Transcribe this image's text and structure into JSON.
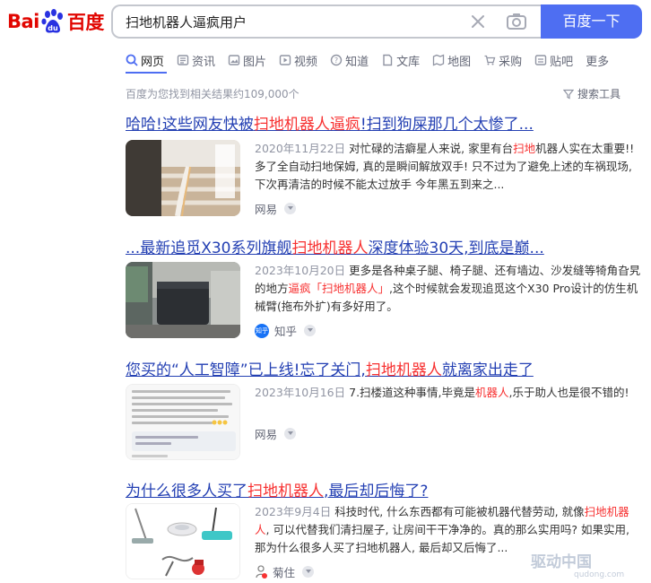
{
  "logo": {
    "left": "Bai",
    "right": "百度"
  },
  "search": {
    "query": "扫地机器人逼疯用户",
    "button": "百度一下"
  },
  "tabs": [
    {
      "label": "网页",
      "icon": "search-icon"
    },
    {
      "label": "资讯",
      "icon": "news-icon"
    },
    {
      "label": "图片",
      "icon": "image-icon"
    },
    {
      "label": "视频",
      "icon": "video-icon"
    },
    {
      "label": "知道",
      "icon": "question-icon"
    },
    {
      "label": "文库",
      "icon": "document-icon"
    },
    {
      "label": "地图",
      "icon": "map-icon"
    },
    {
      "label": "采购",
      "icon": "cart-icon"
    },
    {
      "label": "贴吧",
      "icon": "forum-icon"
    },
    {
      "label": "更多",
      "icon": ""
    }
  ],
  "stats": "百度为您找到相关结果约109,000个",
  "tools_label": "搜索工具",
  "results": [
    {
      "title_pre": "哈哈!这些网友快被",
      "title_em": "扫地机器人逼疯",
      "title_post": "!扫到狗屎那几个太惨了...",
      "date": "2020年11月22日",
      "abs_pre": "对忙碌的洁癖星人来说, 家里有台",
      "abs_em": "扫地",
      "abs_post": "机器人实在太重要!! 多了全自动扫地保姆, 真的是瞬间解放双手! 只不过为了避免上述的车祸现场, 下次再清洁的时候不能太过放手 今年黑五到来之...",
      "source": "网易"
    },
    {
      "title_pre": "...最新追觅X30系列旗舰",
      "title_em": "扫地机器人",
      "title_post": "深度体验30天,到底是巅...",
      "date": "2023年10月20日",
      "abs_pre": "更多是各种桌子腿、椅子腿、还有墙边、沙发缝等犄角旮旯的地方",
      "abs_em": "逼疯「扫地机器人」",
      "abs_post": ",这个时候就会发现追觅这个X30 Pro设计的仿生机械臂(拖布外扩)有多好用了。",
      "source": "知乎",
      "favicon": "知乎"
    },
    {
      "title_pre": "您买的“人工智障”已上线!忘了关门,",
      "title_em": "扫地机器人",
      "title_post": "就离家出走了",
      "date": "2023年10月16日",
      "abs_pre": "7.扫楼道这种事情,毕竟是",
      "abs_em": "机器人",
      "abs_post": ",乐于助人也是很不错的!",
      "source": "网易"
    },
    {
      "title_pre": "为什么很多人买了",
      "title_em": "扫地机器人",
      "title_post": ",最后却后悔了?",
      "date": "2023年9月4日",
      "abs_pre": "科技时代, 什么东西都有可能被机器代替劳动, 就像",
      "abs_em": "扫地机器人",
      "abs_post": ", 可以代替我们清扫屋子, 让房间干干净净的。真的那么实用吗? 如果实用, 那为什么很多人买了扫地机器人, 最后却又后悔了...",
      "source": "菊住"
    }
  ],
  "watermark": {
    "main": "驱动中国",
    "sub": "qudong.com"
  },
  "colors": {
    "brand_blue": "#4e6ef2",
    "link": "#2440b3",
    "highlight": "#f73131",
    "baidu_red": "#e10601"
  }
}
